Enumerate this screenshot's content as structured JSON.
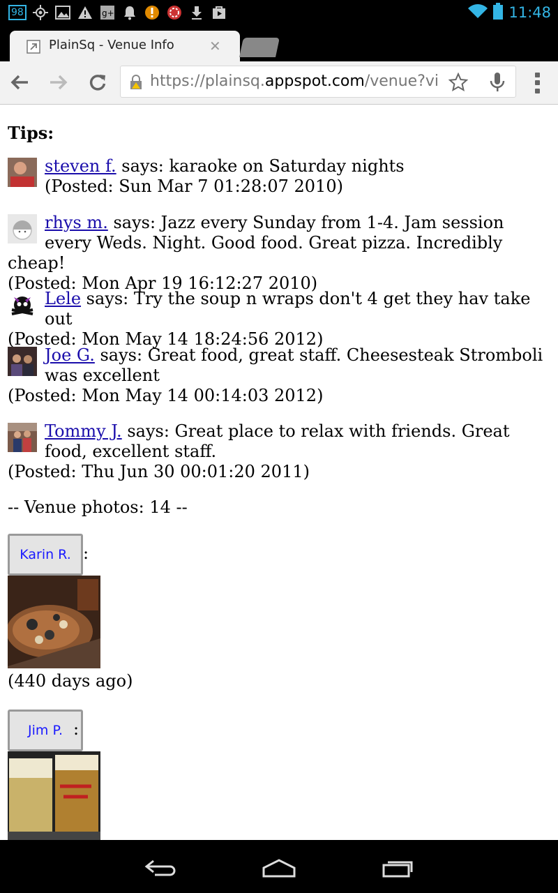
{
  "status_bar": {
    "notification_count": "98",
    "time": "11:48",
    "icons": [
      "badge-98",
      "gps-icon",
      "image-icon",
      "warning-icon",
      "google-plus-icon",
      "bell-icon",
      "alert-icon",
      "pinwheel-icon",
      "download-icon",
      "play-store-icon",
      "wifi-icon",
      "battery-icon"
    ]
  },
  "browser": {
    "tab_title": "PlainSq - Venue Info",
    "url_scheme": "https://plainsq.",
    "url_host": "appspot.com",
    "url_path": "/venue?vi",
    "colors": {
      "accent": "#33b5e5",
      "link": "#1a0dab"
    }
  },
  "page": {
    "heading": "Tips:",
    "tips": [
      {
        "user": "steven f.",
        "text": " says: karaoke on Saturday nights",
        "posted": "(Posted: Sun Mar 7 01:28:07 2010)"
      },
      {
        "user": "rhys m.",
        "text": " says: Jazz every Sunday from 1-4. Jam session every Weds. Night. Good food. Great pizza. Incredibly cheap!",
        "posted": "(Posted: Mon Apr 19 16:12:27 2010)"
      },
      {
        "user": "Lele",
        "text": " says: Try the soup n wraps don't 4 get they hav take out",
        "posted": "(Posted: Mon May 14 18:24:56 2012)"
      },
      {
        "user": "Joe G.",
        "text": " says: Great food, great staff. Cheesesteak Stromboli was excellent",
        "posted": "(Posted: Mon May 14 00:14:03 2012)"
      },
      {
        "user": "Tommy J.",
        "text": " says: Great place to relax with friends. Great food, excellent staff.",
        "posted": "(Posted: Thu Jun 30 00:01:20 2011)"
      }
    ],
    "photos_label": "-- Venue photos: 14 --",
    "photos": [
      {
        "user": "Karin R.",
        "colon": ":",
        "ago": "(440 days ago)"
      },
      {
        "user": "Jim P.",
        "colon": ":"
      }
    ]
  }
}
